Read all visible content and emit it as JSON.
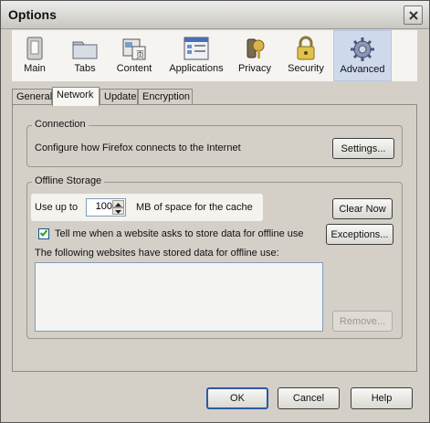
{
  "window": {
    "title": "Options"
  },
  "toolbar": {
    "items": [
      {
        "label": "Main"
      },
      {
        "label": "Tabs"
      },
      {
        "label": "Content"
      },
      {
        "label": "Applications"
      },
      {
        "label": "Privacy"
      },
      {
        "label": "Security"
      },
      {
        "label": "Advanced",
        "selected": true
      }
    ]
  },
  "tabs": [
    {
      "label": "General"
    },
    {
      "label": "Network",
      "active": true
    },
    {
      "label": "Update"
    },
    {
      "label": "Encryption"
    }
  ],
  "connection": {
    "title": "Connection",
    "description": "Configure how Firefox connects to the Internet",
    "settings_button": "Settings..."
  },
  "offline": {
    "title": "Offline Storage",
    "use_up_to_label": "Use up to",
    "cache_value": "100",
    "cache_units_label": "MB of space for the cache",
    "clear_now_button": "Clear Now",
    "tell_me_label": "Tell me when a website asks to store data for offline use",
    "tell_me_checked": true,
    "exceptions_button": "Exceptions...",
    "websites_label": "The following websites have stored data for offline use:",
    "remove_button": "Remove..."
  },
  "footer": {
    "ok_button": "OK",
    "cancel_button": "Cancel",
    "help_button": "Help"
  },
  "colors": {
    "window_bg": "#d4d0c8",
    "selected_tab_bg": "#cfd9ec",
    "default_button_border": "#2d58a8"
  },
  "icons": [
    "main-icon",
    "tabs-icon",
    "content-icon",
    "applications-icon",
    "privacy-icon",
    "security-icon",
    "advanced-icon",
    "close-icon",
    "checkmark-icon",
    "spin-up-icon",
    "spin-down-icon"
  ]
}
